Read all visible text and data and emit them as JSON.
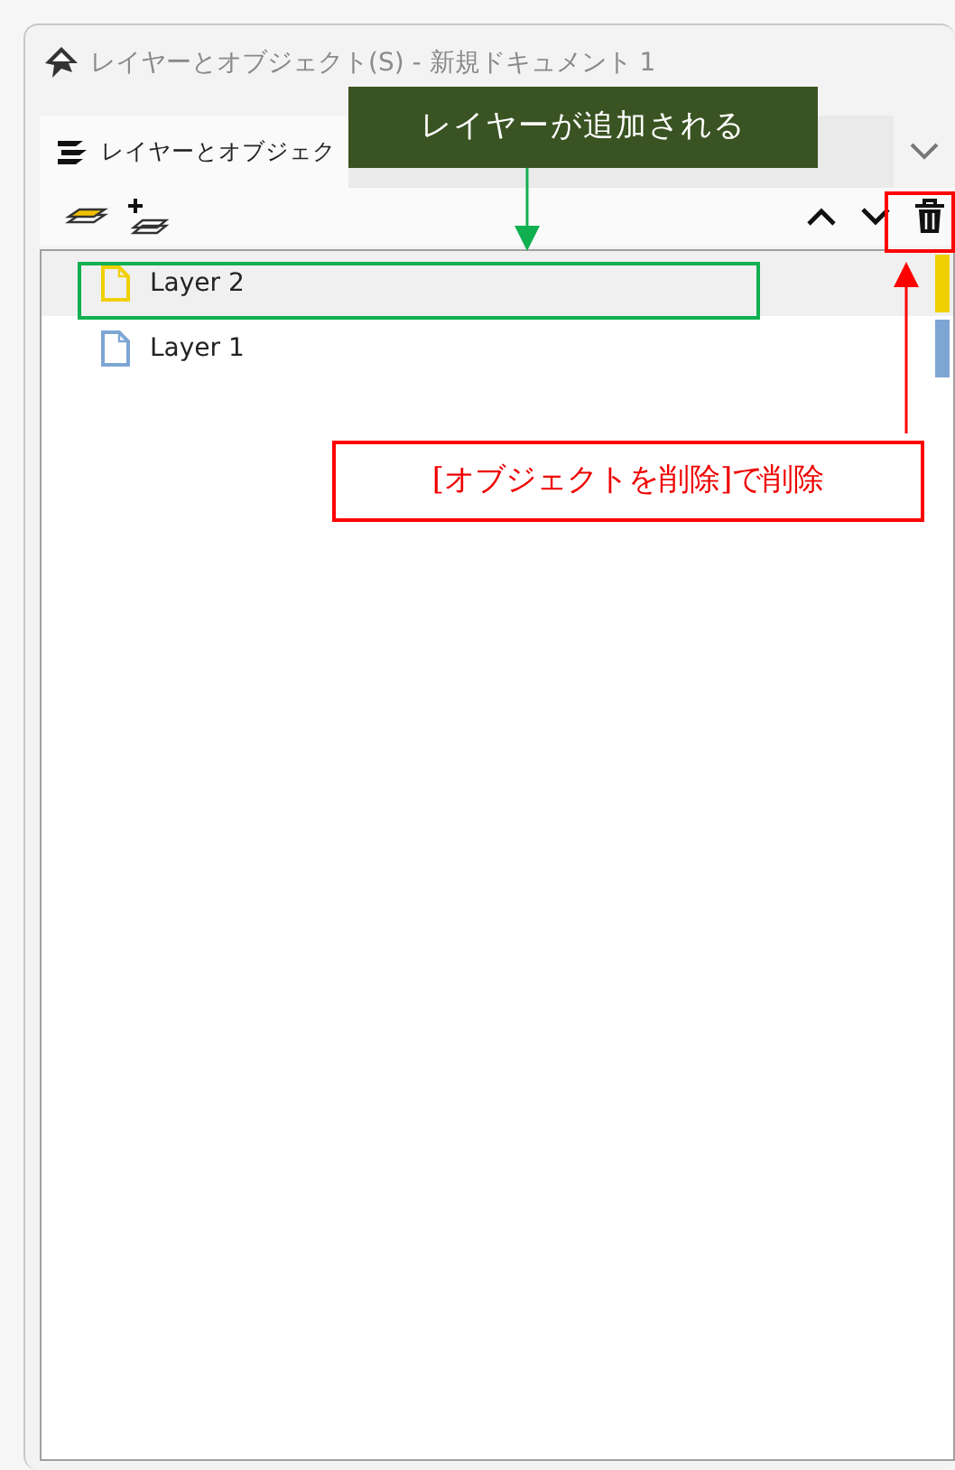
{
  "window": {
    "title": "レイヤーとオブジェクト(S) - 新規ドキュメント 1"
  },
  "tabs": [
    {
      "label": "レイヤーとオブジェク",
      "selected": true
    }
  ],
  "layers": [
    {
      "name": "Layer 2",
      "selected": true,
      "color": "#f0d000"
    },
    {
      "name": "Layer 1",
      "selected": false,
      "color": "#7ea6d4"
    }
  ],
  "annotations": [
    {
      "kind": "callout",
      "text": "レイヤーが追加される"
    },
    {
      "kind": "note",
      "text": "[オブジェクトを削除]で削除"
    }
  ]
}
